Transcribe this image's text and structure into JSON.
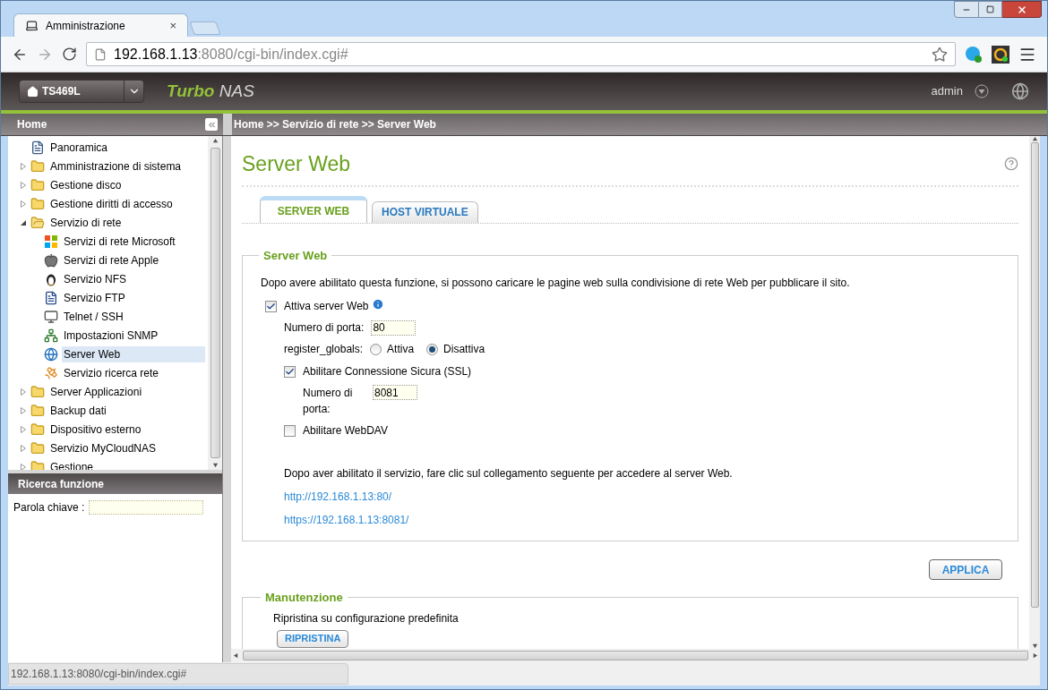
{
  "browser": {
    "tabs": [
      {
        "title": "Amministrazione",
        "close": "×",
        "selected": true
      }
    ],
    "address": {
      "host": "192.168.1.13",
      "path": ":8080/cgi-bin/index.cgi#"
    }
  },
  "header": {
    "device": "TS469L",
    "brand_bold": "Turbo",
    "brand_light": "NAS",
    "user": "admin"
  },
  "sidebar": {
    "title": "Home",
    "tree": [
      {
        "label": "Panoramica",
        "kind": "page",
        "selected": false
      },
      {
        "label": "Amministrazione di sistema",
        "kind": "folder",
        "expanded": false,
        "selected": false
      },
      {
        "label": "Gestione disco",
        "kind": "folder",
        "expanded": false,
        "selected": false
      },
      {
        "label": "Gestione diritti di accesso",
        "kind": "folder",
        "expanded": false,
        "selected": false
      },
      {
        "label": "Servizio di rete",
        "kind": "folder",
        "expanded": true,
        "selected": false,
        "children": [
          {
            "label": "Servizi di rete Microsoft",
            "selected": false
          },
          {
            "label": "Servizi di rete Apple",
            "selected": false
          },
          {
            "label": "Servizio NFS",
            "selected": false
          },
          {
            "label": "Servizio FTP",
            "selected": false
          },
          {
            "label": "Telnet / SSH",
            "selected": false
          },
          {
            "label": "Impostazioni SNMP",
            "selected": false
          },
          {
            "label": "Server Web",
            "selected": true
          },
          {
            "label": "Servizio ricerca rete",
            "selected": false
          }
        ]
      },
      {
        "label": "Server Applicazioni",
        "kind": "folder",
        "expanded": false,
        "selected": false
      },
      {
        "label": "Backup dati",
        "kind": "folder",
        "expanded": false,
        "selected": false
      },
      {
        "label": "Dispositivo esterno",
        "kind": "folder",
        "expanded": false,
        "selected": false
      },
      {
        "label": "Servizio MyCloudNAS",
        "kind": "folder",
        "expanded": false,
        "selected": false
      },
      {
        "label": "Gestione",
        "kind": "folder",
        "expanded": false,
        "selected": false
      }
    ],
    "search": {
      "title": "Ricerca funzione",
      "label": "Parola chiave :"
    }
  },
  "breadcrumb": "Home >> Servizio di rete >> Server Web",
  "page": {
    "title": "Server Web",
    "tabs": [
      {
        "label": "SERVER WEB",
        "selected": true
      },
      {
        "label": "HOST VIRTUALE",
        "selected": false
      }
    ],
    "web_section": {
      "legend": "Server Web",
      "intro": "Dopo avere abilitato questa funzione, si possono caricare le pagine web sulla condivisione di rete Web per pubblicare il sito.",
      "enable": {
        "label": "Attiva server Web",
        "checked": true
      },
      "port": {
        "label": "Numero di porta:",
        "value": "80"
      },
      "register_globals": {
        "label": "register_globals:",
        "options": [
          {
            "label": "Attiva",
            "selected": false
          },
          {
            "label": "Disattiva",
            "selected": true
          }
        ]
      },
      "ssl": {
        "label": "Abilitare Connessione Sicura (SSL)",
        "checked": true
      },
      "ssl_port": {
        "label": "Numero di porta:",
        "value": "8081"
      },
      "webdav": {
        "label": "Abilitare WebDAV",
        "checked": false
      },
      "note": "Dopo aver abilitato il servizio, fare clic sul collegamento seguente per accedere al server Web.",
      "links": [
        "http://192.168.1.13:80/",
        "https://192.168.1.13:8081/"
      ]
    },
    "apply": "APPLICA",
    "maintenance": {
      "legend": "Manutenzione",
      "text": "Ripristina su configurazione predefinita",
      "button": "RIPRISTINA"
    }
  },
  "status_bar": "192.168.1.13:8080/cgi-bin/index.cgi#"
}
